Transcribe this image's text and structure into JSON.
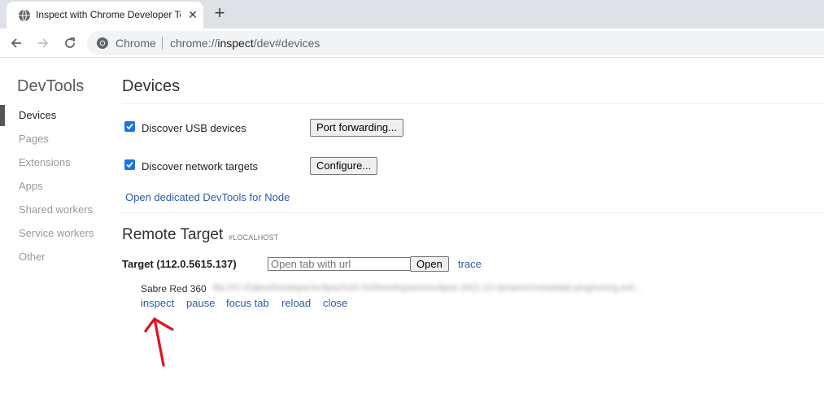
{
  "browser": {
    "tab": {
      "title": "Inspect with Chrome Developer Tools",
      "favicon": "globe-icon"
    },
    "omnibox": {
      "chip": "Chrome",
      "url_prefix": "chrome://",
      "url_host": "inspect",
      "url_path": "/dev#devices"
    }
  },
  "sidebar": {
    "title": "DevTools",
    "items": [
      {
        "label": "Devices",
        "selected": true
      },
      {
        "label": "Pages"
      },
      {
        "label": "Extensions"
      },
      {
        "label": "Apps"
      },
      {
        "label": "Shared workers"
      },
      {
        "label": "Service workers"
      },
      {
        "label": "Other"
      }
    ]
  },
  "main": {
    "title": "Devices",
    "usb": {
      "label": "Discover USB devices",
      "checked": true,
      "button": "Port forwarding..."
    },
    "network": {
      "label": "Discover network targets",
      "checked": true,
      "button": "Configure..."
    },
    "node_link": "Open dedicated DevTools for Node",
    "remote": {
      "title": "Remote Target",
      "tag": "#LOCALHOST",
      "target_name": "Target (112.0.5615.137)",
      "url_placeholder": "Open tab with url",
      "open_button": "Open",
      "trace_link": "trace",
      "page": {
        "name": "Sabre Red 360",
        "url": "file:///C:/SabreDeveloper/eclipse%20-%20workspaces/eclipse-2021-12-dynamic/metadata/.plugins/org.ecli...",
        "actions": [
          "inspect",
          "pause",
          "focus tab",
          "reload",
          "close"
        ]
      }
    }
  },
  "colors": {
    "link": "#2c5ba8",
    "checkbox": "#1a73e8",
    "annotation_arrow": "#e0131b"
  }
}
